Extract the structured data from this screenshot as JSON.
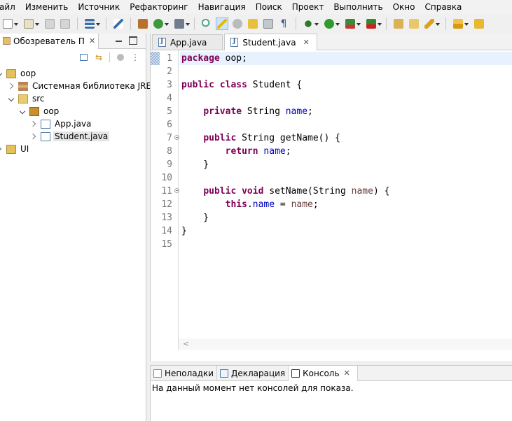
{
  "menu": [
    "айл",
    "Изменить",
    "Источник",
    "Рефакторинг",
    "Навигация",
    "Поиск",
    "Проект",
    "Выполнить",
    "Окно",
    "Справка"
  ],
  "explorer": {
    "tab_label": "Обозреватель П",
    "tree": [
      {
        "label": "oop",
        "name": "tree-project-oop",
        "icon": "project-folder-icon"
      },
      {
        "label": "Системная библиотека JRE [J",
        "name": "tree-jre-library",
        "icon": "library-icon"
      },
      {
        "label": "src",
        "name": "tree-src-folder",
        "icon": "source-folder-icon"
      },
      {
        "label": "oop",
        "name": "tree-package-oop",
        "icon": "package-icon"
      },
      {
        "label": "App.java",
        "name": "tree-file-app-java",
        "icon": "java-file-icon"
      },
      {
        "label": "Student.java",
        "name": "tree-file-student-java",
        "icon": "java-file-icon"
      },
      {
        "label": "UI",
        "name": "tree-project-ui",
        "icon": "project-folder-icon"
      }
    ]
  },
  "editor": {
    "tabs": [
      {
        "label": "App.java",
        "active": false
      },
      {
        "label": "Student.java",
        "active": true
      }
    ],
    "line_numbers": [
      "1",
      "2",
      "3",
      "4",
      "5",
      "6",
      "7",
      "8",
      "9",
      "10",
      "11",
      "12",
      "13",
      "14",
      "15"
    ],
    "code": [
      [
        {
          "t": "package",
          "c": "kw"
        },
        {
          "t": " oop;",
          "c": ""
        }
      ],
      [],
      [
        {
          "t": "public",
          "c": "kw"
        },
        {
          "t": " ",
          "c": ""
        },
        {
          "t": "class",
          "c": "kw"
        },
        {
          "t": " Student {",
          "c": ""
        }
      ],
      [],
      [
        {
          "t": "    ",
          "c": ""
        },
        {
          "t": "private",
          "c": "kw"
        },
        {
          "t": " String ",
          "c": ""
        },
        {
          "t": "name",
          "c": "fld"
        },
        {
          "t": ";",
          "c": ""
        }
      ],
      [],
      [
        {
          "t": "    ",
          "c": ""
        },
        {
          "t": "public",
          "c": "kw"
        },
        {
          "t": " String getName() {",
          "c": ""
        }
      ],
      [
        {
          "t": "        ",
          "c": ""
        },
        {
          "t": "return",
          "c": "kw"
        },
        {
          "t": " ",
          "c": ""
        },
        {
          "t": "name",
          "c": "fld"
        },
        {
          "t": ";",
          "c": ""
        }
      ],
      [
        {
          "t": "    }",
          "c": ""
        }
      ],
      [],
      [
        {
          "t": "    ",
          "c": ""
        },
        {
          "t": "public",
          "c": "kw"
        },
        {
          "t": " ",
          "c": ""
        },
        {
          "t": "void",
          "c": "kw"
        },
        {
          "t": " setName(String ",
          "c": ""
        },
        {
          "t": "name",
          "c": "par"
        },
        {
          "t": ") {",
          "c": ""
        }
      ],
      [
        {
          "t": "        ",
          "c": ""
        },
        {
          "t": "this",
          "c": "kw"
        },
        {
          "t": ".",
          "c": ""
        },
        {
          "t": "name",
          "c": "fld"
        },
        {
          "t": " = ",
          "c": ""
        },
        {
          "t": "name",
          "c": "par"
        },
        {
          "t": ";",
          "c": ""
        }
      ],
      [
        {
          "t": "    }",
          "c": ""
        }
      ],
      [
        {
          "t": "}",
          "c": ""
        }
      ],
      []
    ],
    "fold_lines": [
      7,
      11
    ],
    "scroll_glyph": "<"
  },
  "bottom": {
    "tabs": [
      {
        "label": "Неполадки",
        "name": "tab-problems",
        "icon": "problems-icon"
      },
      {
        "label": "Декларация",
        "name": "tab-declaration",
        "icon": "declaration-icon"
      },
      {
        "label": "Консоль",
        "name": "tab-console",
        "icon": "console-icon",
        "active": true
      }
    ],
    "console_message": "На данный момент нет консолей для показа."
  },
  "colors": {
    "keyword": "#7f0055",
    "field": "#0000c0",
    "parameter": "#6a3e3e",
    "line_number": "#787878",
    "current_line": "#e8f2fe"
  }
}
